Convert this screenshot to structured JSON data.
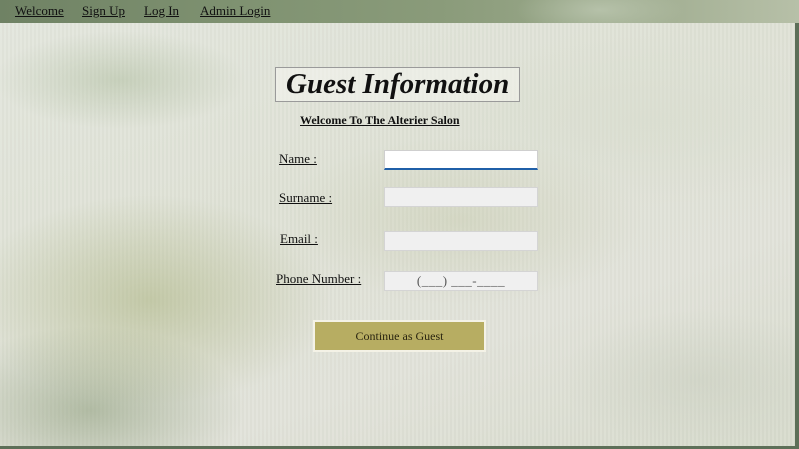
{
  "nav": {
    "welcome": "Welcome",
    "sign_up": "Sign Up",
    "log_in": "Log In",
    "admin_login": "Admin Login"
  },
  "page": {
    "title": "Guest Information",
    "subtitle": "Welcome To The Alterier Salon"
  },
  "form": {
    "name_label": "Name :",
    "name_value": "",
    "surname_label": "Surname :",
    "surname_value": "",
    "email_label": "Email :",
    "email_value": "",
    "phone_label": "Phone Number :",
    "phone_mask": "(___) ___-____",
    "submit_label": "Continue as Guest"
  },
  "colors": {
    "button_bg": "#b7ad62",
    "focus_underline": "#1f5fa8",
    "nav_bg": "#7f9271"
  }
}
